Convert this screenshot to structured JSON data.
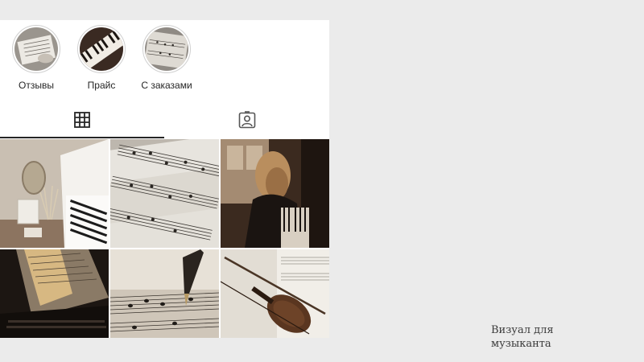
{
  "highlights": [
    {
      "label": "Отзывы"
    },
    {
      "label": "Прайс"
    },
    {
      "label": "С заказами"
    }
  ],
  "tabs": {
    "grid_icon": "grid-icon",
    "tagged_icon": "tagged-person-icon"
  },
  "posts": [
    {
      "subject": "white-piano-room"
    },
    {
      "subject": "sheet-music"
    },
    {
      "subject": "woman-playing-piano"
    },
    {
      "subject": "piano-keys-sunlight"
    },
    {
      "subject": "fountain-pen-music"
    },
    {
      "subject": "violin-on-score"
    }
  ],
  "caption": {
    "line1": "Визуал для",
    "line2": "музыканта"
  },
  "colors": {
    "background": "#ebebeb",
    "panel": "#ffffff",
    "text": "#262626"
  }
}
